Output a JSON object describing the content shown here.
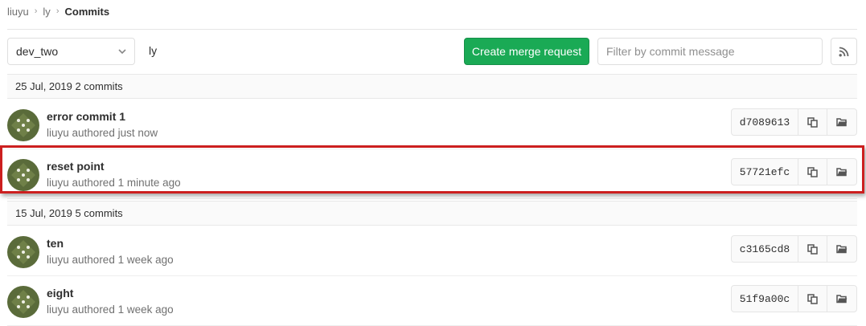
{
  "breadcrumb": {
    "items": [
      "liuyu",
      "ly"
    ],
    "current": "Commits"
  },
  "toolbar": {
    "branch": "dev_two",
    "path": "ly",
    "merge_label": "Create merge request",
    "filter_placeholder": "Filter by commit message",
    "rss_icon": "rss-icon"
  },
  "groups": [
    {
      "header": "25 Jul, 2019 2 commits",
      "commits": [
        {
          "title": "error commit 1",
          "author": "liuyu",
          "authored": "authored just now",
          "sha": "d7089613"
        },
        {
          "title": "reset point",
          "author": "liuyu",
          "authored": "authored 1 minute ago",
          "sha": "57721efc"
        }
      ]
    },
    {
      "header": "15 Jul, 2019 5 commits",
      "commits": [
        {
          "title": "ten",
          "author": "liuyu",
          "authored": "authored 1 week ago",
          "sha": "c3165cd8"
        },
        {
          "title": "eight",
          "author": "liuyu",
          "authored": "authored 1 week ago",
          "sha": "51f9a00c"
        }
      ]
    }
  ],
  "colors": {
    "merge": "#1aaa55",
    "avatar": "#5a6b3a",
    "highlight": "#cc1f1f"
  }
}
